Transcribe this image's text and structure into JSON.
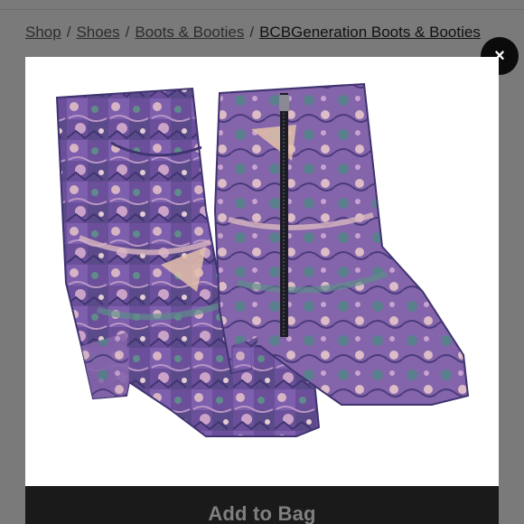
{
  "breadcrumb": {
    "items": [
      {
        "label": "Shop"
      },
      {
        "label": "Shoes"
      },
      {
        "label": "Boots & Booties"
      }
    ],
    "current": "BCBGeneration Boots & Booties",
    "separator": "/"
  },
  "modal": {
    "close_label": "×",
    "add_to_bag_label": "Add to Bag"
  },
  "colors": {
    "overlay": "#7a7a7a",
    "button_bg": "#1a1a1a",
    "boot_purple": "#6a4e98",
    "boot_pink": "#d8b0b8",
    "boot_teal": "#5f8b8a"
  },
  "icons": {
    "close": "close-icon"
  }
}
